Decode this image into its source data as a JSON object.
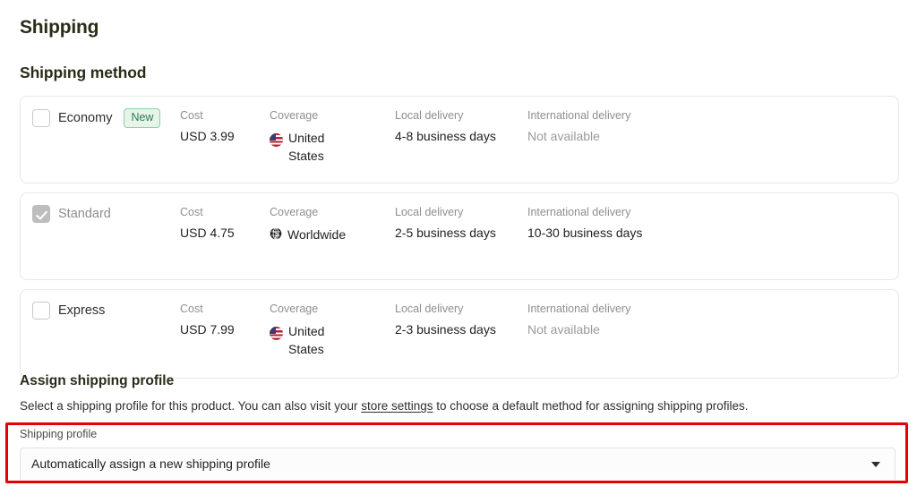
{
  "page_title": "Shipping",
  "section_title": "Shipping method",
  "columns": {
    "cost": "Cost",
    "coverage": "Coverage",
    "local_delivery": "Local delivery",
    "international_delivery": "International delivery"
  },
  "methods": [
    {
      "name": "Economy",
      "badge": "New",
      "checked": false,
      "disabled": false,
      "cost": "USD 3.99",
      "coverage": "United States",
      "coverage_icon": "us-flag-icon",
      "local_delivery": "4-8 business days",
      "international_delivery": "Not available",
      "international_available": false
    },
    {
      "name": "Standard",
      "badge": "",
      "checked": true,
      "disabled": true,
      "cost": "USD 4.75",
      "coverage": "Worldwide",
      "coverage_icon": "globe-icon",
      "local_delivery": "2-5 business days",
      "international_delivery": "10-30 business days",
      "international_available": true
    },
    {
      "name": "Express",
      "badge": "",
      "checked": false,
      "disabled": false,
      "cost": "USD 7.99",
      "coverage": "United States",
      "coverage_icon": "us-flag-icon",
      "local_delivery": "2-3 business days",
      "international_delivery": "Not available",
      "international_available": false
    }
  ],
  "assign": {
    "title": "Assign shipping profile",
    "description_before": "Select a shipping profile for this product. You can also visit your ",
    "link_text": "store settings",
    "description_after": " to choose a default method for assigning shipping profiles.",
    "field_label": "Shipping profile",
    "selected_value": "Automatically assign a new shipping profile"
  },
  "colors": {
    "highlight": "#e60000",
    "badge_text": "#2f7d47",
    "badge_bg": "#e6f4ea",
    "badge_border": "#8fcfa4",
    "heading": "#2b2b18"
  }
}
